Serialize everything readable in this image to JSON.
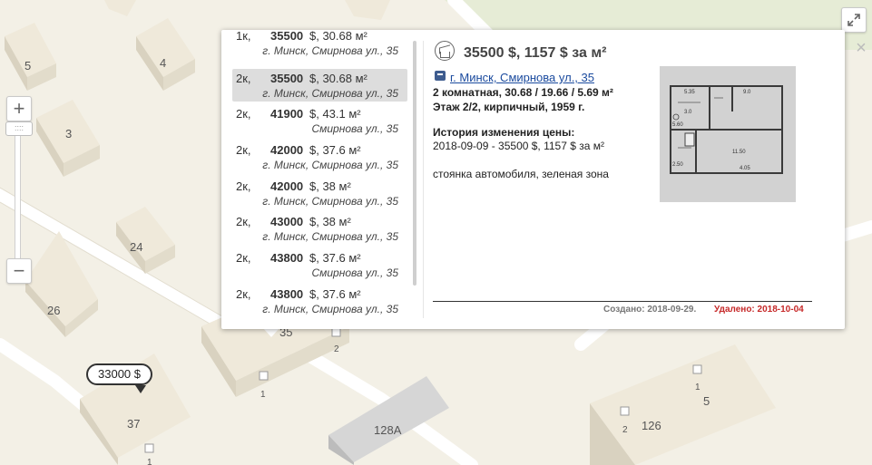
{
  "map": {
    "building_labels": [
      "5",
      "4",
      "3",
      "24",
      "26",
      "35",
      "37",
      "128A",
      "126",
      "5"
    ],
    "entrance_labels": [
      "2",
      "1",
      "1",
      "1",
      "2"
    ],
    "price_marker": "33000 $",
    "zoom_in_label": "+",
    "zoom_out_label": "−",
    "zoom_handle_label": "::::"
  },
  "popup": {
    "close_label": "×",
    "listings": [
      {
        "rooms": "1к,",
        "price": "35500",
        "area": "$, 30.68 м²",
        "addr": "г. Минск, Смирнова ул., 35"
      },
      {
        "rooms": "2к,",
        "price": "35500",
        "area": "$, 30.68 м²",
        "addr": "г. Минск, Смирнова ул., 35",
        "selected": true
      },
      {
        "rooms": "2к,",
        "price": "41900",
        "area": "$, 43.1 м²",
        "addr": "Смирнова ул., 35"
      },
      {
        "rooms": "2к,",
        "price": "42000",
        "area": "$, 37.6 м²",
        "addr": "г. Минск, Смирнова ул., 35"
      },
      {
        "rooms": "2к,",
        "price": "42000",
        "area": "$, 38 м²",
        "addr": "г. Минск, Смирнова ул., 35"
      },
      {
        "rooms": "2к,",
        "price": "43000",
        "area": "$, 38 м²",
        "addr": "г. Минск, Смирнова ул., 35"
      },
      {
        "rooms": "2к,",
        "price": "43800",
        "area": "$, 37.6 м²",
        "addr": "Смирнова ул., 35"
      },
      {
        "rooms": "2к,",
        "price": "43800",
        "area": "$, 37.6 м²",
        "addr": "г. Минск, Смирнова ул., 35"
      }
    ],
    "detail": {
      "price_title": "35500 $, 1157 $ за м²",
      "address": "г. Минск, Смирнова ул., 35",
      "spec_line1": "2 комнатная, 30.68 / 19.66 / 5.69 м²",
      "spec_line2": "Этаж 2/2, кирпичный, 1959 г.",
      "history_title": "История изменения цены:",
      "history_entry": "2018-09-09 - 35500 $, 1157 $ за м²",
      "notes": "стоянка автомобиля, зеленая зона",
      "created": "Создано: 2018-09-29.",
      "deleted": "Удалено: 2018-10-04",
      "plan_labels": [
        "5.35",
        "9.0",
        "3.0",
        "5.60",
        "2.50",
        "11.50",
        "4.05"
      ]
    }
  },
  "colors": {
    "ground": "#f3f0e6",
    "building_top": "#efe9da",
    "building_side": "#d9d2c0",
    "grass": "#e6ecd6",
    "road": "#ffffff",
    "deleted": "#c62828",
    "link": "#1a4a9e"
  }
}
